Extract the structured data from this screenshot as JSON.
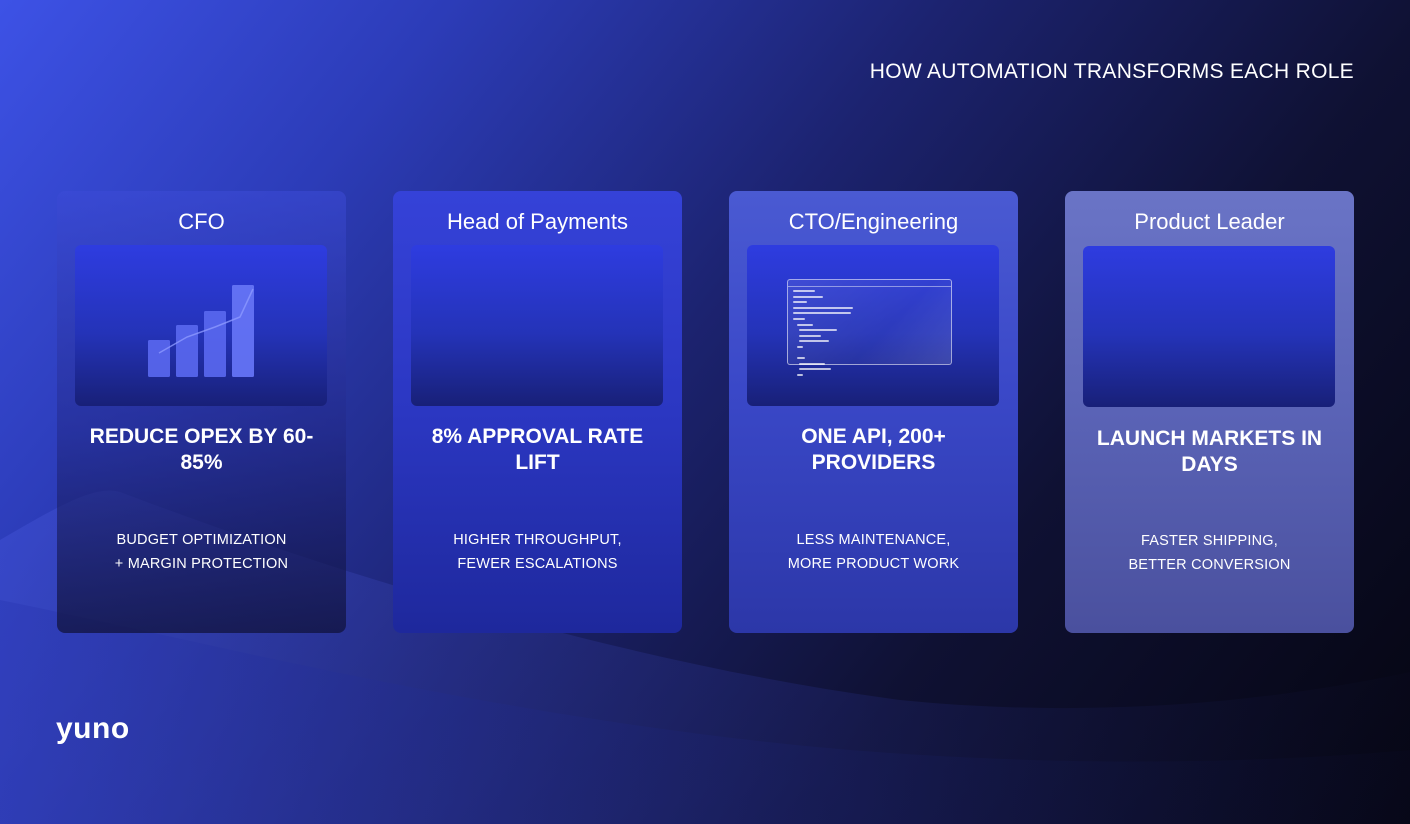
{
  "slide": {
    "headline": "HOW AUTOMATION TRANSFORMS EACH ROLE",
    "logo": "yuno",
    "cards": [
      {
        "title": "CFO",
        "metric": "REDUCE OPEX BY 60-85%",
        "sub_line1": "BUDGET OPTIMIZATION",
        "sub_line2": "+ MARGIN PROTECTION",
        "icon": "bar-chart-icon"
      },
      {
        "title": "Head of Payments",
        "metric": "8% APPROVAL RATE LIFT",
        "sub_line1": "HIGHER THROUGHPUT,",
        "sub_line2": "FEWER ESCALATIONS",
        "icon": ""
      },
      {
        "title": "CTO/Engineering",
        "metric": "ONE API, 200+ PROVIDERS",
        "sub_line1": "LESS MAINTENANCE,",
        "sub_line2": "MORE PRODUCT WORK",
        "icon": "code-window-icon"
      },
      {
        "title": "Product Leader",
        "metric": "LAUNCH MARKETS IN DAYS",
        "sub_line1": "FASTER SHIPPING,",
        "sub_line2": "BETTER CONVERSION",
        "icon": ""
      }
    ]
  },
  "colors": {
    "background_start": "#3d52e6",
    "background_end": "#050510",
    "bar_fill": "#5a68f0",
    "text": "#ffffff"
  }
}
